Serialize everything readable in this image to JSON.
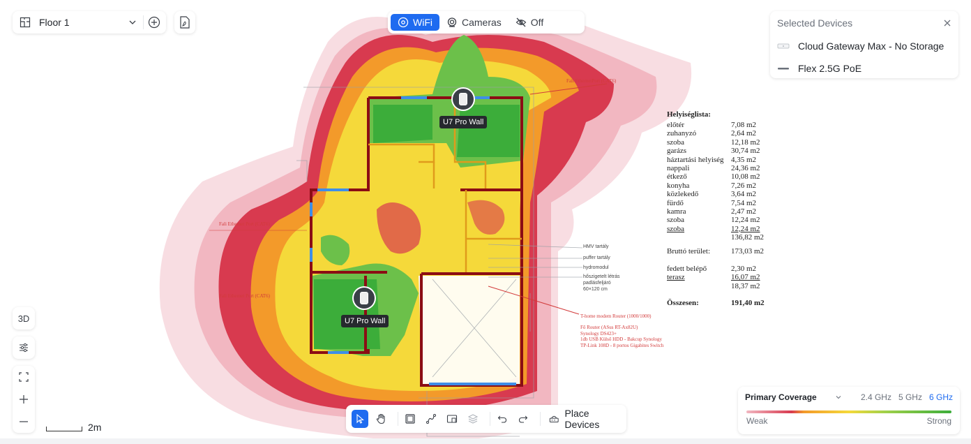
{
  "floor_selector": {
    "label": "Floor 1",
    "icon": "floor-plan-icon"
  },
  "mode_bar": {
    "modes": [
      {
        "label": "WiFi",
        "icon": "wifi-icon",
        "active": true
      },
      {
        "label": "Cameras",
        "icon": "camera-icon",
        "active": false
      },
      {
        "label": "Off",
        "icon": "eye-off-icon",
        "active": false
      }
    ]
  },
  "selected_devices": {
    "title": "Selected Devices",
    "items": [
      {
        "name": "Cloud Gateway Max - No Storage"
      },
      {
        "name": "Flex 2.5G PoE"
      }
    ]
  },
  "access_points": [
    {
      "label": "U7 Pro Wall"
    },
    {
      "label": "U7 Pro Wall"
    }
  ],
  "left_tools": {
    "view_3d_label": "3D"
  },
  "scale": {
    "label": "2m"
  },
  "toolbar": {
    "place_label": "Place Devices"
  },
  "coverage": {
    "title": "Primary Coverage",
    "bands": [
      "2.4 GHz",
      "5 GHz",
      "6 GHz"
    ],
    "active_band": "6 GHz",
    "weak_label": "Weak",
    "strong_label": "Strong"
  },
  "floorplan": {
    "room_list_title": "Helyiséglista:",
    "rooms": [
      {
        "name": "előtér",
        "area": "7,08 m2"
      },
      {
        "name": "zuhanyzó",
        "area": "2,64 m2"
      },
      {
        "name": "szoba",
        "area": "12,18 m2"
      },
      {
        "name": "garázs",
        "area": "30,74 m2"
      },
      {
        "name": "háztartási helyiség",
        "area": "4,35 m2"
      },
      {
        "name": "nappali",
        "area": "24,36 m2"
      },
      {
        "name": "étkező",
        "area": "10,08 m2"
      },
      {
        "name": "konyha",
        "area": "7,26 m2"
      },
      {
        "name": "közlekedő",
        "area": "3,64 m2"
      },
      {
        "name": "fürdő",
        "area": "7,54 m2"
      },
      {
        "name": "kamra",
        "area": "2,47 m2"
      },
      {
        "name": "szoba",
        "area": "12,24 m2"
      },
      {
        "name": "szoba",
        "area": "12,24 m2"
      }
    ],
    "subtotal": "136,82 m2",
    "brutto_label": "Bruttó terület:",
    "brutto_value": "173,03 m2",
    "fedett_label": "fedett belépő",
    "fedett_value": "2,30 m2",
    "terasz_label": "terasz",
    "terasz_value": "16,07 m2",
    "sum2": "18,37 m2",
    "total_label": "Összesen:",
    "total_value": "191,40 m2",
    "side_labels": [
      "HMV tartály",
      "puffer tartály",
      "hydromodul",
      "hőszigetelt létrás",
      "padlásfeljáró",
      "60×120 cm"
    ],
    "router_annotations": [
      "T-home modem Router (1000/1000)",
      "Fő Router (ASus RT-Ax82U)",
      "Synology DS423+",
      "1db USB Külső HDD - Bakcup Synology",
      "TP-Link 108D - 8 portos Gigabites Switch"
    ],
    "left_annotations": [
      "Fali Ethernet Port (CAT6)",
      "Fali Ethernet Port (CAT6)"
    ],
    "top_annotation": "Fali EthernetPort (CAT6)"
  },
  "colors": {
    "accent": "#1e6bf0",
    "wall": "#8b0d14",
    "strong": "#3cad3a",
    "mid": "#f5d93a",
    "weak": "#d83a4f"
  }
}
